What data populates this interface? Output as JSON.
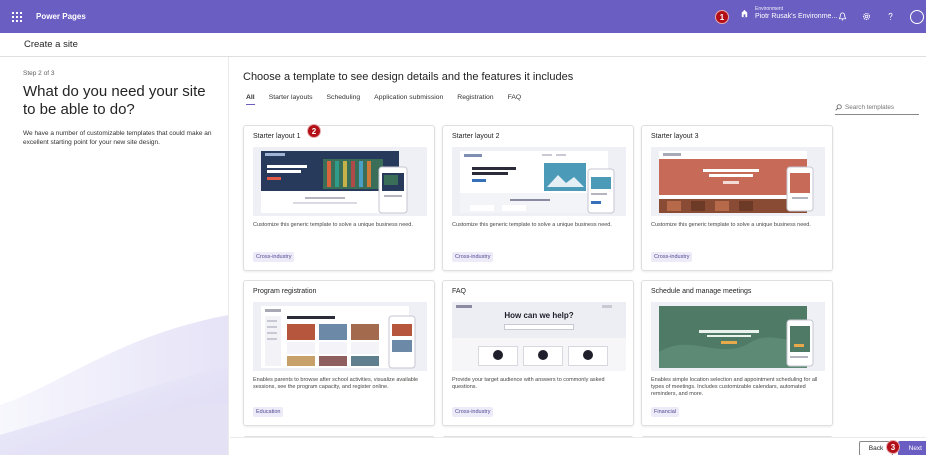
{
  "topbar": {
    "app_name": "Power Pages",
    "environment_label": "Environment",
    "environment_name": "Piotr Rusak's Environme...",
    "markers": [
      "1",
      "2",
      "3"
    ]
  },
  "subheader": {
    "title": "Create a site"
  },
  "left": {
    "step": "Step 2 of 3",
    "question": "What do you need your site to be able to do?",
    "description": "We have a number of customizable templates that could make an excellent starting point for your new site design."
  },
  "main": {
    "title": "Choose a template to see design details and the features it includes",
    "tabs": [
      "All",
      "Starter layouts",
      "Scheduling",
      "Application submission",
      "Registration",
      "FAQ"
    ],
    "search_placeholder": "Search templates"
  },
  "cards": [
    {
      "title": "Starter layout 1",
      "description": "Customize this generic template to solve a unique business need.",
      "tag": "Cross-industry"
    },
    {
      "title": "Starter layout 2",
      "description": "Customize this generic template to solve a unique business need.",
      "tag": "Cross-industry"
    },
    {
      "title": "Starter layout 3",
      "description": "Customize this generic template to solve a unique business need.",
      "tag": "Cross-industry"
    },
    {
      "title": "Program registration",
      "description": "Enables parents to browse after school activities, visualize available sessions, see the program capacity, and register online.",
      "tag": "Education"
    },
    {
      "title": "FAQ",
      "description": "Provide your target audience with answers to commonly asked questions.",
      "tag": "Cross-industry",
      "preview_heading": "How can we help?"
    },
    {
      "title": "Schedule and manage meetings",
      "description": "Enables simple location selection and appointment scheduling for all types of meetings. Includes customizable calendars, automated reminders, and more.",
      "tag": "Financial"
    }
  ],
  "footer": {
    "back_label": "Back",
    "next_label": "Next"
  },
  "colors": {
    "brand": "#6b5ec3",
    "marker": "#b30f17",
    "tag_bg": "#edebf8"
  }
}
